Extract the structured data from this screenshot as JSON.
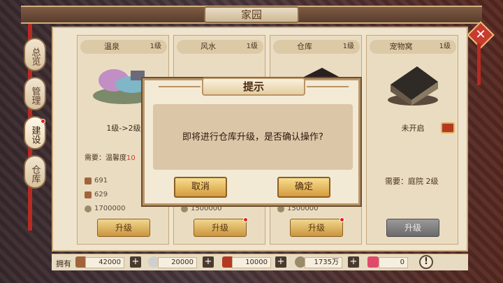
{
  "header": {
    "title": "家园"
  },
  "side_tabs": [
    {
      "label": "总览"
    },
    {
      "label": "管理"
    },
    {
      "label": "建设"
    },
    {
      "label": "仓库"
    }
  ],
  "cards": [
    {
      "name": "温泉",
      "level": "1级",
      "state": "1级->2级",
      "req_label": "需要：温馨度",
      "req_value": "10",
      "res": [
        "691",
        "629",
        "1700000"
      ],
      "button": "升级"
    },
    {
      "name": "风水",
      "level": "1级",
      "state": "",
      "req_label": "",
      "req_value": "",
      "res": [
        "",
        "",
        "1500000"
      ],
      "button": "升级"
    },
    {
      "name": "仓库",
      "level": "1级",
      "state": "",
      "req_label": "",
      "req_value": "",
      "res": [
        "",
        "",
        "1500000"
      ],
      "button": "升级"
    },
    {
      "name": "宠物窝",
      "level": "1级",
      "state": "未开启",
      "req_label": "需要：庭院  2级",
      "req_value": "",
      "res": [],
      "button": "升级"
    }
  ],
  "bottom": {
    "label": "拥有",
    "resources": [
      "42000",
      "20000",
      "10000",
      "1735万",
      "0"
    ],
    "plus": "+",
    "info": "!"
  },
  "dialog": {
    "title": "提示",
    "message": "即将进行仓库升级，是否确认操作?",
    "cancel": "取消",
    "confirm": "确定"
  },
  "close": "✕"
}
